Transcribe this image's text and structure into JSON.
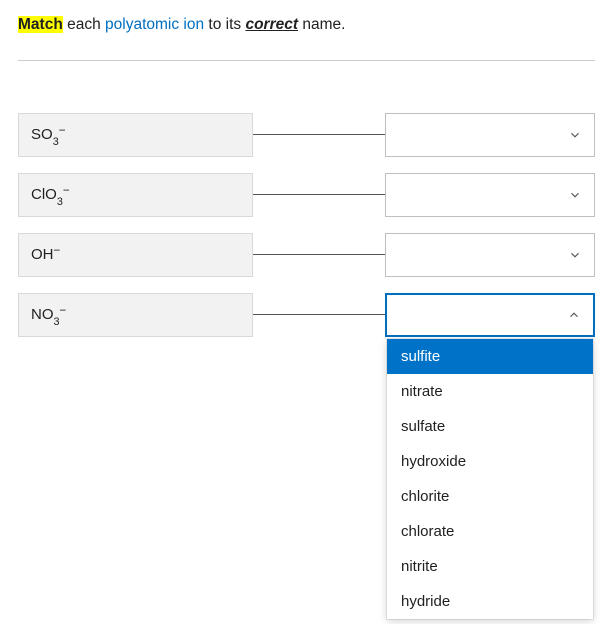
{
  "prompt": {
    "word_match": "Match",
    "word_each": " each ",
    "word_polyatomic": "polyatomic ion",
    "word_toits": " to its ",
    "word_correct": "correct",
    "word_name": " name."
  },
  "rows": [
    {
      "ion": {
        "prefix": "SO",
        "sub": "3",
        "sup": "−"
      },
      "selected": "",
      "open": false
    },
    {
      "ion": {
        "prefix": "ClO",
        "sub": "3",
        "sup": "−"
      },
      "selected": "",
      "open": false
    },
    {
      "ion": {
        "prefix": "OH",
        "sub": "",
        "sup": "−"
      },
      "selected": "",
      "open": false
    },
    {
      "ion": {
        "prefix": "NO",
        "sub": "3",
        "sup": "−"
      },
      "selected": "",
      "open": true
    }
  ],
  "options": [
    "sulfite",
    "nitrate",
    "sulfate",
    "hydroxide",
    "chlorite",
    "chlorate",
    "nitrite",
    "hydride"
  ],
  "highlighted_option_index": 0
}
